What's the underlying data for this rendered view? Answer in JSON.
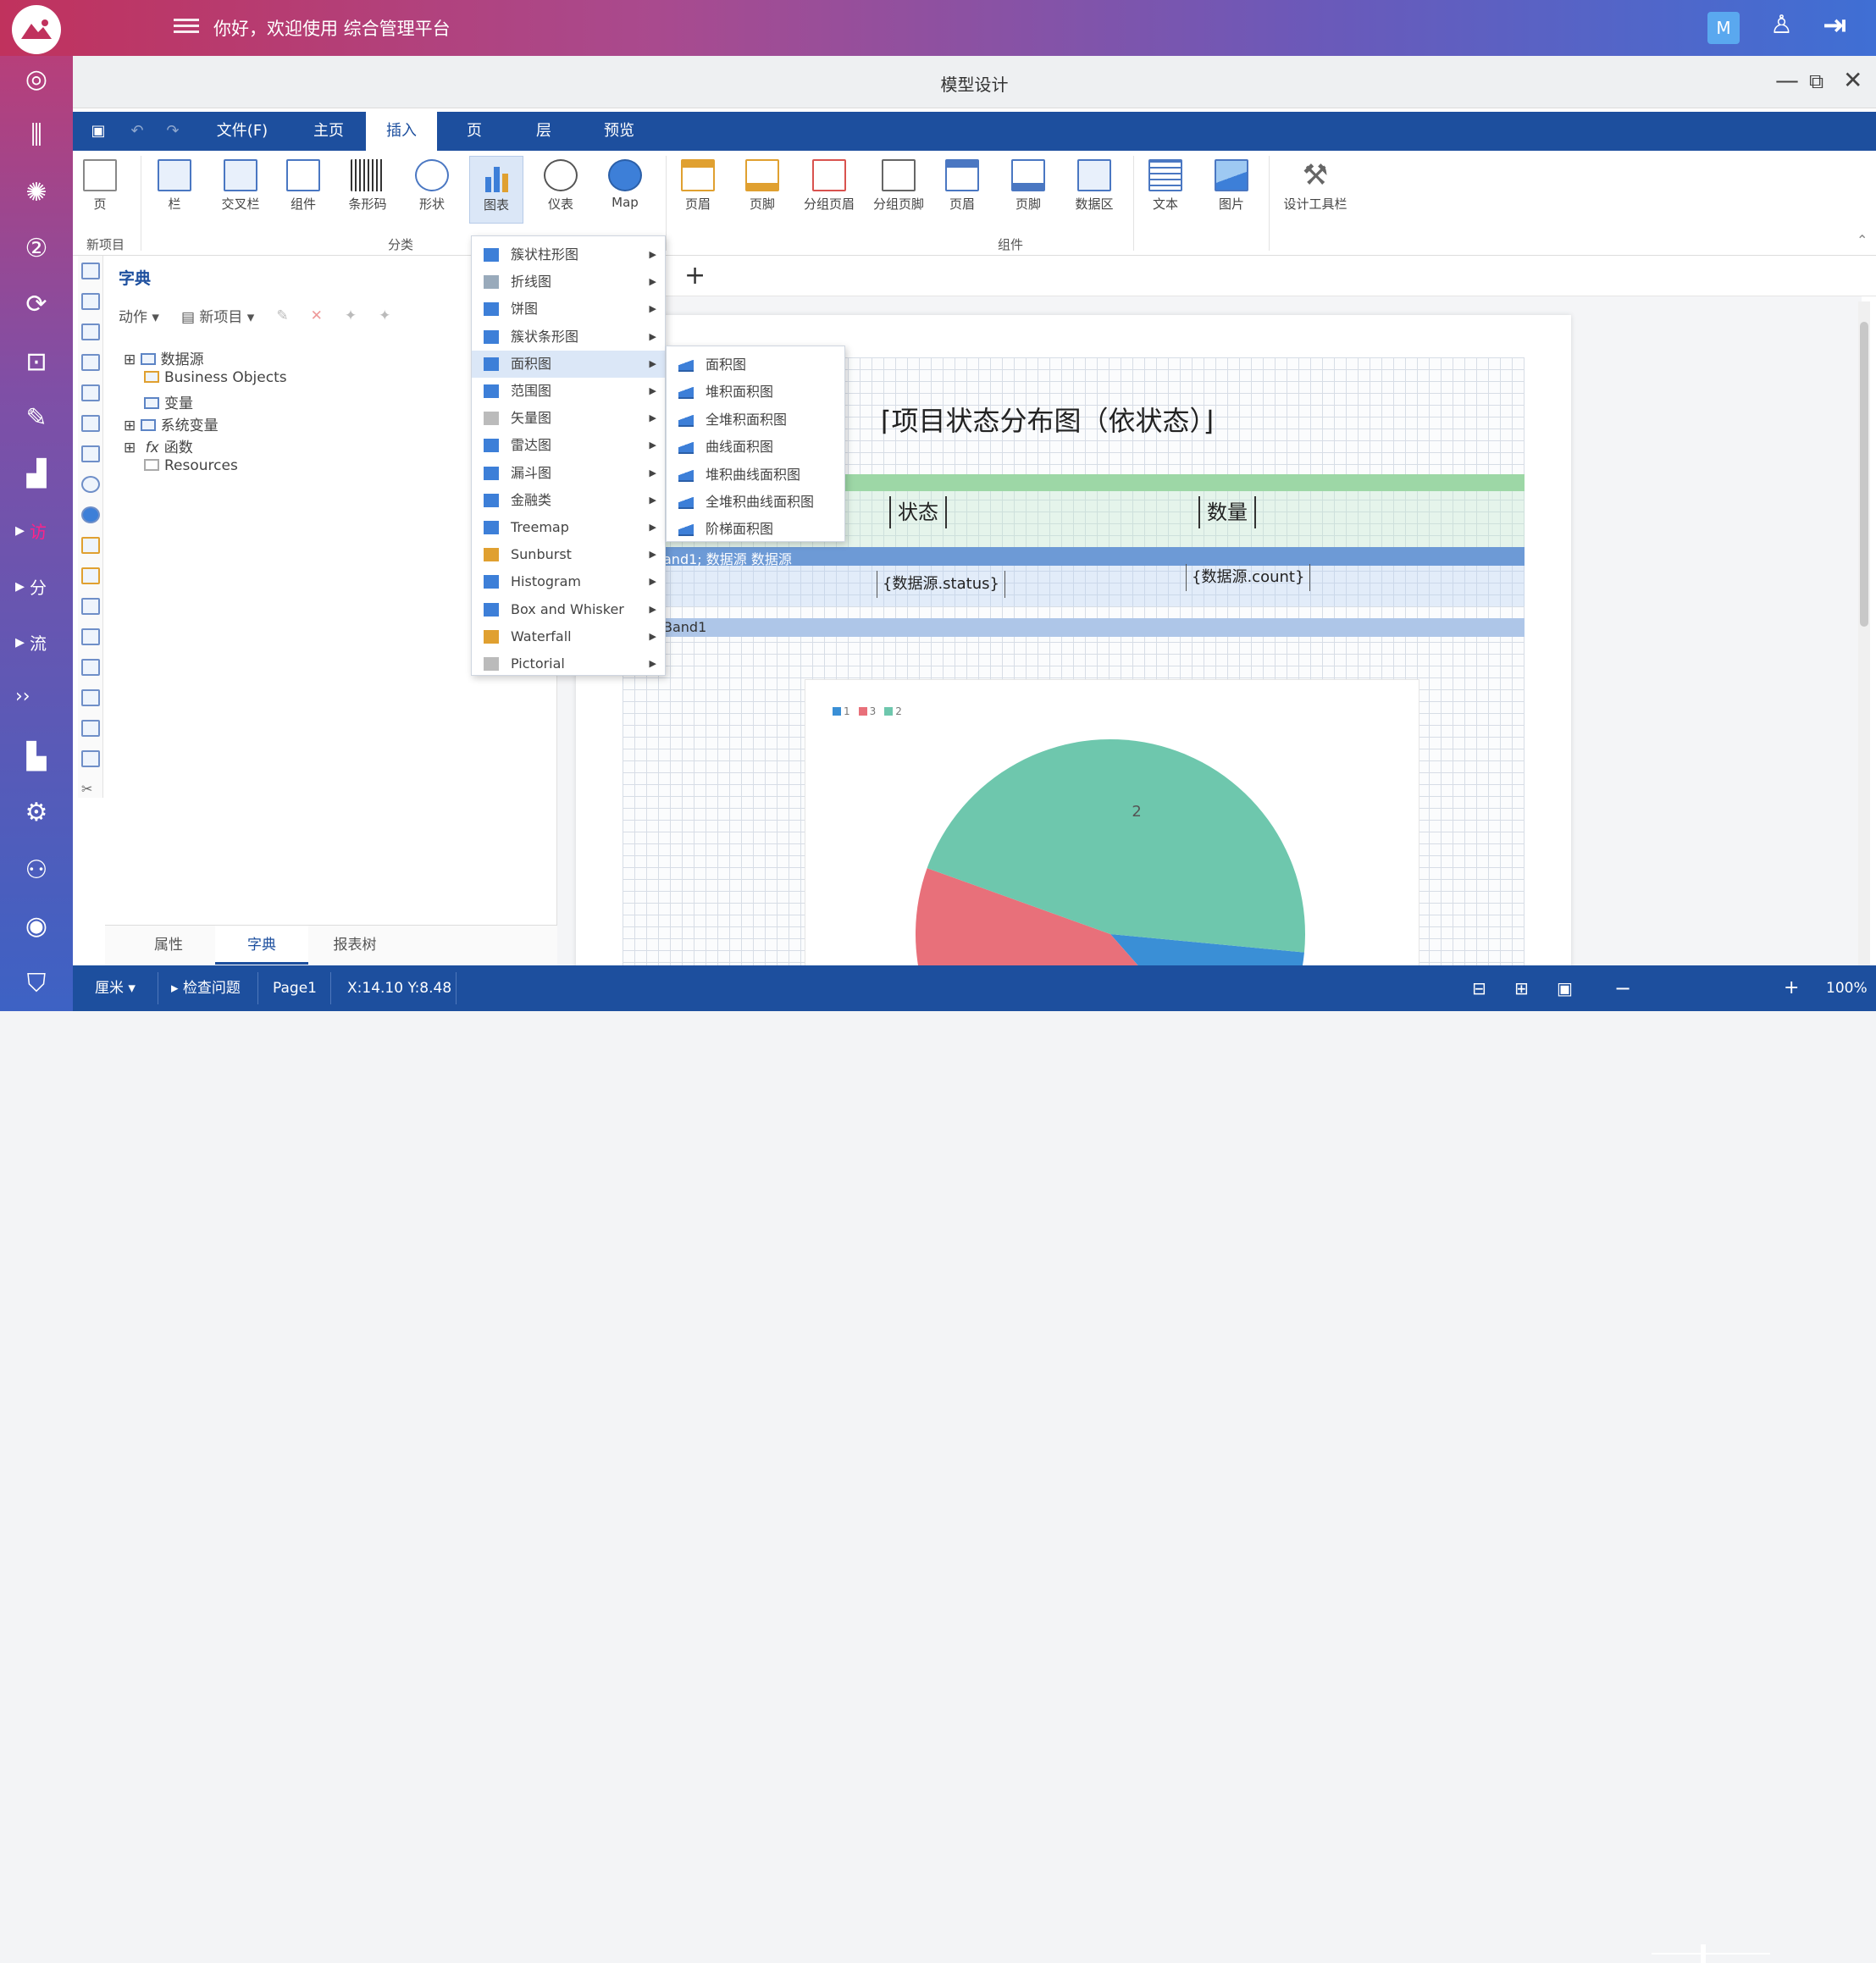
{
  "header": {
    "greeting": "你好，欢迎使用 综合管理平台",
    "user_initial": "M"
  },
  "window": {
    "title": "模型设计"
  },
  "leftnav": {
    "collapsed_labels": [
      "访",
      "分",
      "流"
    ],
    "more": "››"
  },
  "menubar": {
    "items": [
      "文件(F)",
      "主页",
      "插入",
      "页",
      "层",
      "预览"
    ],
    "active": "插入"
  },
  "ribbon": {
    "buttons": [
      "页",
      "栏",
      "交叉栏",
      "组件",
      "条形码",
      "形状",
      "图表",
      "仪表",
      "Map",
      "页眉",
      "页脚",
      "分组页眉",
      "分组页脚",
      "页眉",
      "页脚",
      "数据区",
      "文本",
      "图片",
      "设计工具栏"
    ],
    "groups": [
      "新项目",
      "分类",
      "组件"
    ]
  },
  "dictionary": {
    "title": "字典",
    "toolbar": {
      "action": "动作",
      "new_item": "新项目"
    },
    "tree": [
      "数据源",
      "Business Objects",
      "变量",
      "系统变量",
      "函数",
      "Resources"
    ],
    "tabs": [
      "属性",
      "字典",
      "报表树"
    ],
    "active_tab": "字典"
  },
  "design": {
    "report_title": "项目状态分布图（依状态）",
    "col_status": "状态",
    "col_count": "数量",
    "band_data": "and1; 数据源 数据源",
    "field_status": "{数据源.status}",
    "field_count": "{数据源.count}",
    "band_footer": "Band1"
  },
  "chart_menu": {
    "items": [
      "簇状柱形图",
      "折线图",
      "饼图",
      "簇状条形图",
      "面积图",
      "范围图",
      "矢量图",
      "雷达图",
      "漏斗图",
      "金融类",
      "Treemap",
      "Sunburst",
      "Histogram",
      "Box and Whisker",
      "Waterfall",
      "Pictorial"
    ],
    "highlighted": "面积图"
  },
  "area_submenu": {
    "items": [
      "面积图",
      "堆积面积图",
      "全堆积面积图",
      "曲线面积图",
      "堆积曲线面积图",
      "全堆积曲线面积图",
      "阶梯面积图"
    ]
  },
  "statusbar": {
    "unit": "厘米",
    "check": "检查问题",
    "page": "Page1",
    "coords": "X:14.10 Y:8.48",
    "zoom": "100%"
  },
  "chart_data": {
    "type": "pie",
    "categories": [
      "1",
      "3",
      "2"
    ],
    "values": [
      12,
      42,
      46
    ],
    "legend": [
      "1",
      "3",
      "2"
    ],
    "colors": [
      "#3a8fd6",
      "#e8707a",
      "#6ec7ad"
    ]
  }
}
